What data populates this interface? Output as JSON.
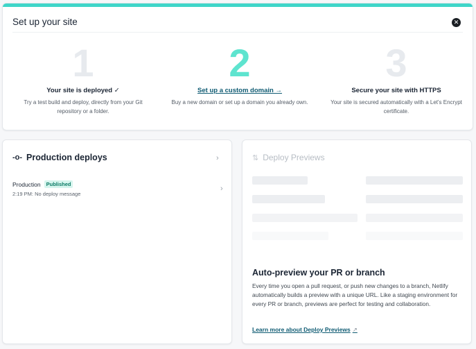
{
  "setup": {
    "title": "Set up your site",
    "close_icon": "close-icon",
    "steps": [
      {
        "number": "1",
        "title": "Your site is deployed ✓",
        "description": "Try a test build and deploy, directly from your Git repository or a folder."
      },
      {
        "number": "2",
        "title": "Set up a custom domain →",
        "description": "Buy a new domain or set up a domain you already own."
      },
      {
        "number": "3",
        "title": "Secure your site with HTTPS",
        "description": "Your site is secured automatically with a Let's Encrypt certificate."
      }
    ]
  },
  "production": {
    "title": "Production deploys",
    "icon": "commit-icon",
    "deploy": {
      "name": "Production",
      "badge": "Published",
      "meta": "2:19 PM: No deploy message"
    }
  },
  "previews": {
    "title": "Deploy Previews",
    "icon": "pull-request-icon",
    "heading": "Auto-preview your PR or branch",
    "description": "Every time you open a pull request, or push new changes to a branch, Netlify automatically builds a preview with a unique URL. Like a staging environment for every PR or branch, previews are perfect for testing and collaboration.",
    "link": "Learn more about Deploy Previews"
  },
  "colors": {
    "accent": "#3fd6c9",
    "step_active": "#5ee4cf",
    "link": "#0f5b73",
    "badge_bg": "#d6f5ee"
  }
}
